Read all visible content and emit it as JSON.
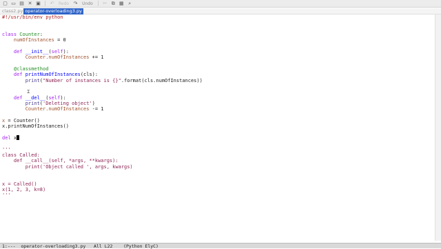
{
  "toolbar": {
    "undo_label": "Undo",
    "redo_label": "Redo"
  },
  "tabs": [
    {
      "label": "class2.py",
      "active": false
    },
    {
      "label": "operator-overloading3.py",
      "active": true
    }
  ],
  "code": [
    "#!/usr/bin/env python",
    "",
    "",
    "class Counter:",
    "    numOfInstances = 0",
    "",
    "    def __init__(self):",
    "        Counter.numOfInstances += 1",
    "",
    "    @classmethod",
    "    def printNumOfInstances(cls):",
    "        print(\"Number of instances is {}\".format(cls.numOfInstances))",
    "",
    "",
    "    def __del__(self):",
    "        print('Deleting object')",
    "        Counter.numOfInstances -= 1",
    "",
    "x = Counter()",
    "x.printNumOfInstances()",
    "",
    "del x",
    "",
    "'''",
    "class Called:",
    "    def __call__(self, *args, **kwargs):",
    "        print('Object called ', args, kwargs)",
    "",
    "",
    "x = Called()",
    "x(1, 2, 3, k=8)",
    "'''"
  ],
  "modeline": "1:---  operator-overloading3.py   All L22    (Python ElyC)",
  "colors": {
    "keyword": "#a020f0",
    "string": "#8b2252",
    "function": "#0000ff",
    "variable": "#a0522d",
    "active_tab": "#2f64c8"
  }
}
